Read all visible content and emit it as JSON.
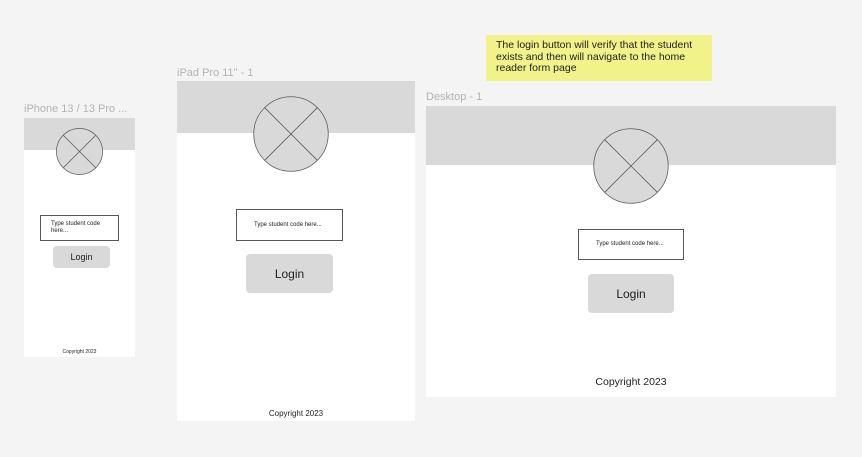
{
  "frames": {
    "iphone": {
      "label": "iPhone 13 / 13 Pro ...",
      "input_placeholder": "Type student code here...",
      "login_label": "Login",
      "copyright": "Copyright 2023"
    },
    "ipad": {
      "label": "iPad Pro 11\" - 1",
      "input_placeholder": "Type student code here...",
      "login_label": "Login",
      "copyright": "Copyright 2023"
    },
    "desktop": {
      "label": "Desktop - 1",
      "input_placeholder": "Type student code here...",
      "login_label": "Login",
      "copyright": "Copyright 2023"
    }
  },
  "sticky_note": {
    "text": "The login button will verify that the student exists and then will navigate to the home reader form page"
  },
  "colors": {
    "canvas": "#f4f4f4",
    "frame_bg": "#ffffff",
    "header_band": "#d9d9d9",
    "button": "#d9d9d9",
    "note": "#f2f28a"
  }
}
